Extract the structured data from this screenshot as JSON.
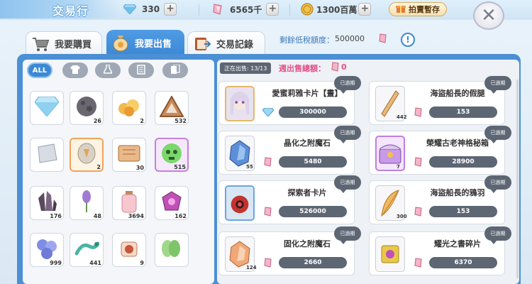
{
  "header": {
    "title": "交易行",
    "gems": "330",
    "mana": "6565千",
    "coins": "1300百萬",
    "auction_button": "拍賣暫存",
    "close_label": "✕"
  },
  "tabs": [
    {
      "label": "我要購買",
      "active": false
    },
    {
      "label": "我要出售",
      "active": true
    },
    {
      "label": "交易記錄",
      "active": false
    }
  ],
  "quota": {
    "label": "剩餘低稅額度：",
    "value": "500000"
  },
  "info_label": "!",
  "filters": [
    {
      "label": "ALL",
      "icon": "all-filter"
    },
    {
      "label": "",
      "icon": "shirt-icon"
    },
    {
      "label": "",
      "icon": "flask-icon"
    },
    {
      "label": "",
      "icon": "scroll-icon"
    },
    {
      "label": "",
      "icon": "card-icon"
    }
  ],
  "inventory": [
    {
      "icon": "diamond-icon",
      "count": ""
    },
    {
      "icon": "dark-ore-icon",
      "count": "26"
    },
    {
      "icon": "gold-ore-icon",
      "count": "2"
    },
    {
      "icon": "triangle-rune-icon",
      "count": "532"
    },
    {
      "icon": "silver-slab-icon",
      "count": ""
    },
    {
      "icon": "rune-stone-icon",
      "count": "2"
    },
    {
      "icon": "wood-plank-icon",
      "count": "30"
    },
    {
      "icon": "skull-orb-icon",
      "count": "515"
    },
    {
      "icon": "dark-crystal-icon",
      "count": "176"
    },
    {
      "icon": "lavender-icon",
      "count": "48"
    },
    {
      "icon": "potion-jar-icon",
      "count": "3694"
    },
    {
      "icon": "magic-gem-icon",
      "count": "162"
    },
    {
      "icon": "blue-flower-icon",
      "count": "999"
    },
    {
      "icon": "lizard-icon",
      "count": "441"
    },
    {
      "icon": "red-jar-icon",
      "count": "9"
    },
    {
      "icon": "green-leaf-icon",
      "count": ""
    }
  ],
  "selling": {
    "badge": "正在出售: 13/13",
    "total_label": "週出售總額：",
    "total_value": "0"
  },
  "listings": [
    {
      "name": "愛蜜莉雅卡片【晝】",
      "price": "300000",
      "currency": "gem",
      "status": "已過期",
      "count": "",
      "thumb": "emilia-card-icon"
    },
    {
      "name": "海盜船長的假腿",
      "price": "153",
      "currency": "mana",
      "status": "已過期",
      "count": "442",
      "thumb": "peg-leg-icon"
    },
    {
      "name": "晶化之附魔石",
      "price": "5480",
      "currency": "mana",
      "status": "已過期",
      "count": "55",
      "thumb": "blue-stone-icon"
    },
    {
      "name": "榮耀古老神格秘箱",
      "price": "28900",
      "currency": "mana",
      "status": "已過期",
      "count": "7",
      "thumb": "chest-icon"
    },
    {
      "name": "探索者卡片",
      "price": "526000",
      "currency": "mana",
      "status": "已過期",
      "count": "",
      "thumb": "explorer-card-icon"
    },
    {
      "name": "海盜船長的鴉羽",
      "price": "153",
      "currency": "mana",
      "status": "已過期",
      "count": "300",
      "thumb": "feather-icon"
    },
    {
      "name": "固化之附魔石",
      "price": "2660",
      "currency": "mana",
      "status": "已過期",
      "count": "124",
      "thumb": "orange-stone-icon"
    },
    {
      "name": "耀光之書碎片",
      "price": "6370",
      "currency": "mana",
      "status": "已過期",
      "count": "",
      "thumb": "book-fragment-icon"
    }
  ]
}
